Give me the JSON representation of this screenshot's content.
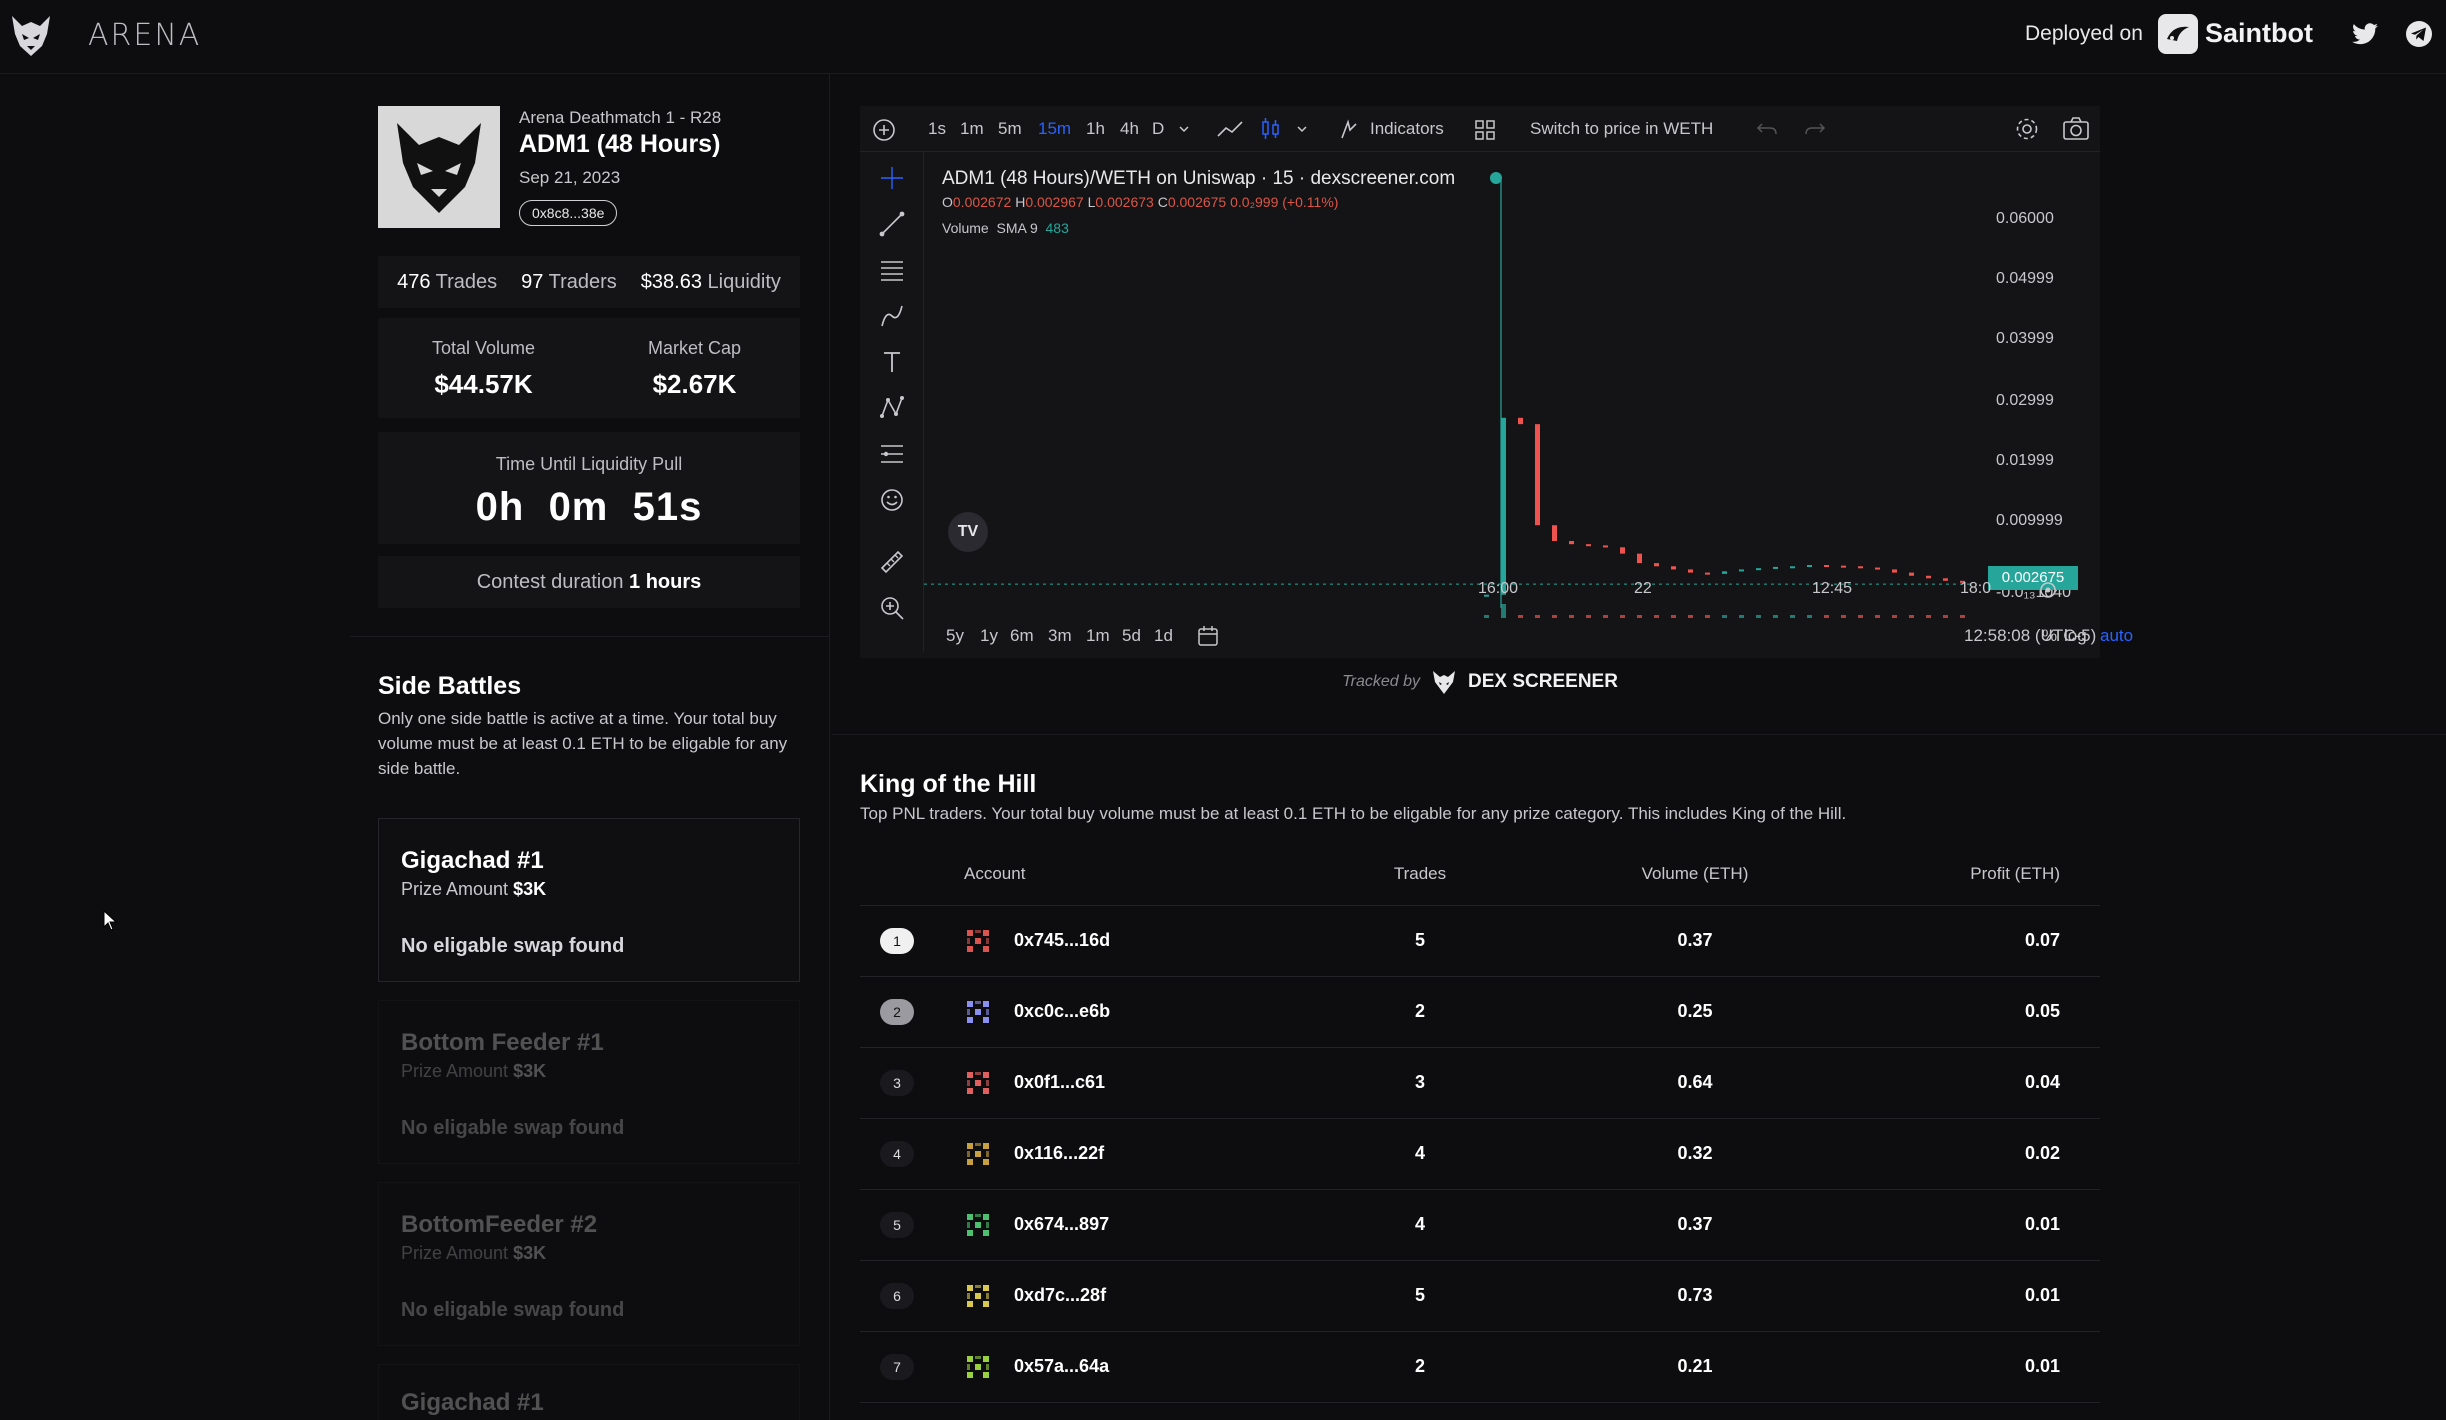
{
  "header": {
    "brand": "ARENA",
    "deployed_label": "Deployed on",
    "partner": "Saintbot"
  },
  "token": {
    "subtitle": "Arena Deathmatch 1 - R28",
    "title": "ADM1 (48 Hours)",
    "date": "Sep 21, 2023",
    "address": "0x8c8...38e"
  },
  "stats": {
    "trades_value": "476",
    "trades_label": "Trades",
    "traders_value": "97",
    "traders_label": "Traders",
    "liquidity_value": "$38.63",
    "liquidity_label": "Liquidity",
    "total_volume_label": "Total Volume",
    "total_volume": "$44.57K",
    "market_cap_label": "Market Cap",
    "market_cap": "$2.67K",
    "time_label": "Time Until Liquidity Pull",
    "time_value": "0h  0m  51s",
    "duration_prefix": "Contest duration",
    "duration_value": "1 hours"
  },
  "side_battles": {
    "title": "Side Battles",
    "description": "Only one side battle is active at a time. Your total buy volume must be at least 0.1 ETH to be eligable for any side battle.",
    "items": [
      {
        "name": "Gigachad #1",
        "prize_label": "Prize Amount",
        "prize": "$3K",
        "status": "No eligable swap found"
      },
      {
        "name": "Bottom Feeder #1",
        "prize_label": "Prize Amount",
        "prize": "$3K",
        "status": "No eligable swap found"
      },
      {
        "name": "BottomFeeder #2",
        "prize_label": "Prize Amount",
        "prize": "$3K",
        "status": "No eligable swap found"
      },
      {
        "name": "Gigachad #1",
        "prize_label": "",
        "prize": "",
        "status": ""
      }
    ]
  },
  "chart": {
    "intervals": [
      "1s",
      "1m",
      "5m",
      "15m",
      "1h",
      "4h",
      "D"
    ],
    "active_interval": "15m",
    "indicators_label": "Indicators",
    "switch_label": "Switch to price in WETH",
    "title": "ADM1 (48 Hours)/WETH on Uniswap · 15 · dexscreener.com",
    "ohlc": {
      "o": "0.002672",
      "h": "0.002967",
      "l": "0.002673",
      "c": "0.002675",
      "change": "0.0₂999 (+0.11%)"
    },
    "volume_label": "Volume",
    "sma_label": "SMA 9",
    "sma_value": "483",
    "price_ticks": [
      "0.06000",
      "0.04999",
      "0.03999",
      "0.02999",
      "0.01999",
      "0.009999",
      "-0.0₁₃1040"
    ],
    "current_price": "0.002675",
    "time_ticks": [
      "16:00",
      "22",
      "12:45",
      "18:0"
    ],
    "ranges": [
      "5y",
      "1y",
      "6m",
      "3m",
      "1m",
      "5d",
      "1d"
    ],
    "clock": "12:58:08 (UTC-5)",
    "scale_pct": "%",
    "scale_log": "log",
    "scale_auto": "auto",
    "accent_color": "#2962ff",
    "up_color": "#26a69a",
    "down_color": "#ef5350",
    "tracked_by": "Tracked by",
    "dex_name": "DEX SCREENER"
  },
  "chart_data": {
    "type": "candlestick",
    "title": "ADM1 (48 Hours)/WETH on Uniswap · 15 · dexscreener.com",
    "ylim": [
      -0.001104,
      0.06
    ],
    "x_ticks": [
      "16:00",
      "22",
      "12:45",
      "18:0"
    ],
    "closes": [
      0.001,
      0.029,
      0.028,
      0.012,
      0.0095,
      0.009,
      0.0088,
      0.0085,
      0.0075,
      0.006,
      0.0055,
      0.005,
      0.0045,
      0.0043,
      0.0047,
      0.005,
      0.0052,
      0.0054,
      0.0055,
      0.0057,
      0.0056,
      0.0055,
      0.0053,
      0.005,
      0.0045,
      0.004,
      0.0036,
      0.0032,
      0.003,
      0.00275,
      0.0026,
      0.00268,
      0.002675
    ]
  },
  "koth": {
    "title": "King of the Hill",
    "description": "Top PNL traders. Your total buy volume must be at least 0.1 ETH to be eligable for any prize category. This includes King of the Hill.",
    "headers": {
      "account": "Account",
      "trades": "Trades",
      "volume": "Volume (ETH)",
      "profit": "Profit (ETH)"
    },
    "rows": [
      {
        "rank": "1",
        "account": "0x745...16d",
        "trades": "5",
        "volume": "0.37",
        "profit": "0.07",
        "color": "#d9534f"
      },
      {
        "rank": "2",
        "account": "0xc0c...e6b",
        "trades": "2",
        "volume": "0.25",
        "profit": "0.05",
        "color": "#8a8ff0"
      },
      {
        "rank": "3",
        "account": "0x0f1...c61",
        "trades": "3",
        "volume": "0.64",
        "profit": "0.04",
        "color": "#e06060"
      },
      {
        "rank": "4",
        "account": "0x116...22f",
        "trades": "4",
        "volume": "0.32",
        "profit": "0.02",
        "color": "#c9a040"
      },
      {
        "rank": "5",
        "account": "0x674...897",
        "trades": "4",
        "volume": "0.37",
        "profit": "0.01",
        "color": "#4cc070"
      },
      {
        "rank": "6",
        "account": "0xd7c...28f",
        "trades": "5",
        "volume": "0.73",
        "profit": "0.01",
        "color": "#d8c850"
      },
      {
        "rank": "7",
        "account": "0x57a...64a",
        "trades": "2",
        "volume": "0.21",
        "profit": "0.01",
        "color": "#9ad040"
      }
    ]
  }
}
